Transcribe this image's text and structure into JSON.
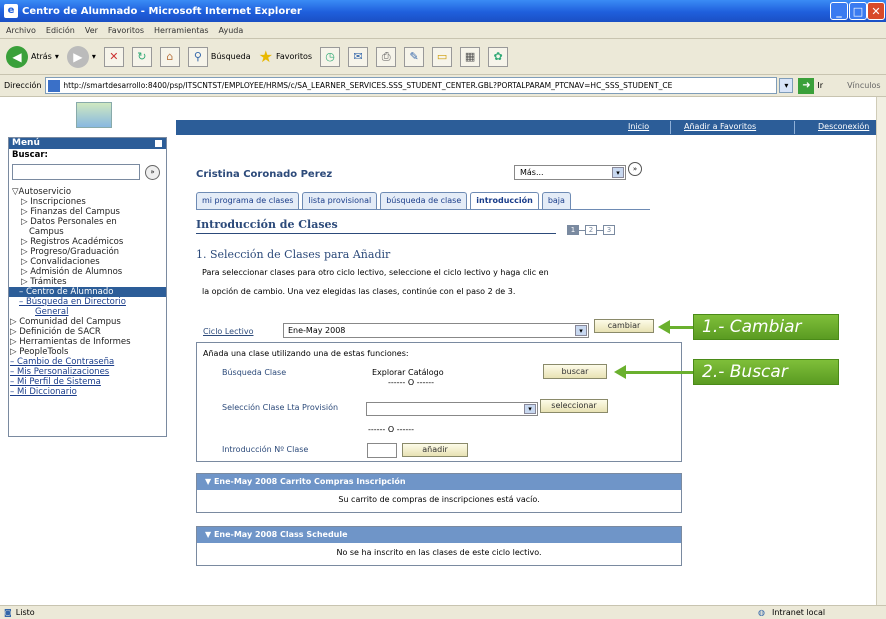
{
  "window": {
    "title": "Centro de Alumnado - Microsoft Internet Explorer"
  },
  "menubar": [
    "Archivo",
    "Edición",
    "Ver",
    "Favoritos",
    "Herramientas",
    "Ayuda"
  ],
  "toolbar": {
    "back_label": "Atrás",
    "search_label": "Búsqueda",
    "favorites_label": "Favoritos"
  },
  "address": {
    "label": "Dirección",
    "url": "http://smartdesarrollo:8400/psp/ITSCNTST/EMPLOYEE/HRMS/c/SA_LEARNER_SERVICES.SSS_STUDENT_CENTER.GBL?PORTALPARAM_PTCNAV=HC_SSS_STUDENT_CE",
    "go_label": "Ir",
    "links_label": "Vínculos"
  },
  "ps_header": {
    "inicio": "Inicio",
    "favoritos": "Añadir a Favoritos",
    "desconexion": "Desconexión"
  },
  "menu": {
    "title": "Menú",
    "search_label": "Buscar:",
    "items": [
      {
        "label": "Autoservicio",
        "type": "folder-open"
      },
      {
        "label": "Inscripciones",
        "type": "sub"
      },
      {
        "label": "Finanzas del Campus",
        "type": "sub"
      },
      {
        "label": "Datos Personales en",
        "type": "sub"
      },
      {
        "label": "Campus",
        "type": "sub-cont"
      },
      {
        "label": "Registros Académicos",
        "type": "sub"
      },
      {
        "label": "Progreso/Graduación",
        "type": "sub"
      },
      {
        "label": "Convalidaciones",
        "type": "sub"
      },
      {
        "label": "Admisión de Alumnos",
        "type": "sub"
      },
      {
        "label": "Trámites",
        "type": "sub"
      },
      {
        "label": "Centro de Alumnado",
        "type": "selected"
      },
      {
        "label": "Búsqueda en Directorio",
        "type": "link"
      },
      {
        "label": "General",
        "type": "link-cont"
      },
      {
        "label": "Comunidad del Campus",
        "type": "top"
      },
      {
        "label": "Definición de SACR",
        "type": "top"
      },
      {
        "label": "Herramientas de Informes",
        "type": "top"
      },
      {
        "label": "PeopleTools",
        "type": "top"
      },
      {
        "label": "Cambio de Contraseña",
        "type": "toplink"
      },
      {
        "label": "Mis Personalizaciones",
        "type": "toplink"
      },
      {
        "label": "Mi Perfil de Sistema",
        "type": "toplink"
      },
      {
        "label": "Mi Diccionario",
        "type": "toplink"
      }
    ]
  },
  "student": {
    "name": "Cristina Coronado Perez",
    "mas_value": "Más..."
  },
  "tabs": [
    {
      "label": "mi programa de clases",
      "active": false
    },
    {
      "label": "lista provisional",
      "active": false
    },
    {
      "label": "búsqueda de clase",
      "active": false
    },
    {
      "label": "introducción",
      "active": true
    },
    {
      "label": "baja",
      "active": false
    }
  ],
  "section": {
    "title": "Introducción de Clases",
    "steps": [
      "1",
      "2",
      "3"
    ],
    "step_heading": "1. Selección de Clases para Añadir",
    "instr1": "Para seleccionar clases para otro ciclo lectivo, seleccione el ciclo lectivo y haga clic en",
    "instr2": "la opción de cambio. Una vez elegidas las clases, continúe con el paso 2 de 3."
  },
  "form": {
    "ciclo_label": "Ciclo Lectivo",
    "ciclo_value": "Ene-May 2008",
    "cambiar": "cambiar",
    "add_label": "Añada una clase utilizando una de estas funciones:",
    "busqueda_label": "Búsqueda Clase",
    "explorar": "Explorar Catálogo",
    "or1": "------ O ------",
    "buscar": "buscar",
    "seleccion_label": "Selección Clase Lta Provisión",
    "seleccionar": "seleccionar",
    "or2": "------ O ------",
    "intro_label": "Introducción Nº Clase",
    "anadir": "añadir"
  },
  "panels": [
    {
      "title": "Ene-May 2008 Carrito Compras Inscripción",
      "body": "Su carrito de compras de inscripciones está vacío."
    },
    {
      "title": "Ene-May 2008 Class Schedule",
      "body": "No se ha inscrito en las clases de este ciclo lectivo."
    }
  ],
  "callouts": {
    "c1": "1.- Cambiar",
    "c2": "2.- Buscar"
  },
  "status": {
    "left": "Listo",
    "zone": "Intranet local"
  },
  "colors": {
    "accent": "#2c5d98",
    "callout": "#6ab02e"
  }
}
